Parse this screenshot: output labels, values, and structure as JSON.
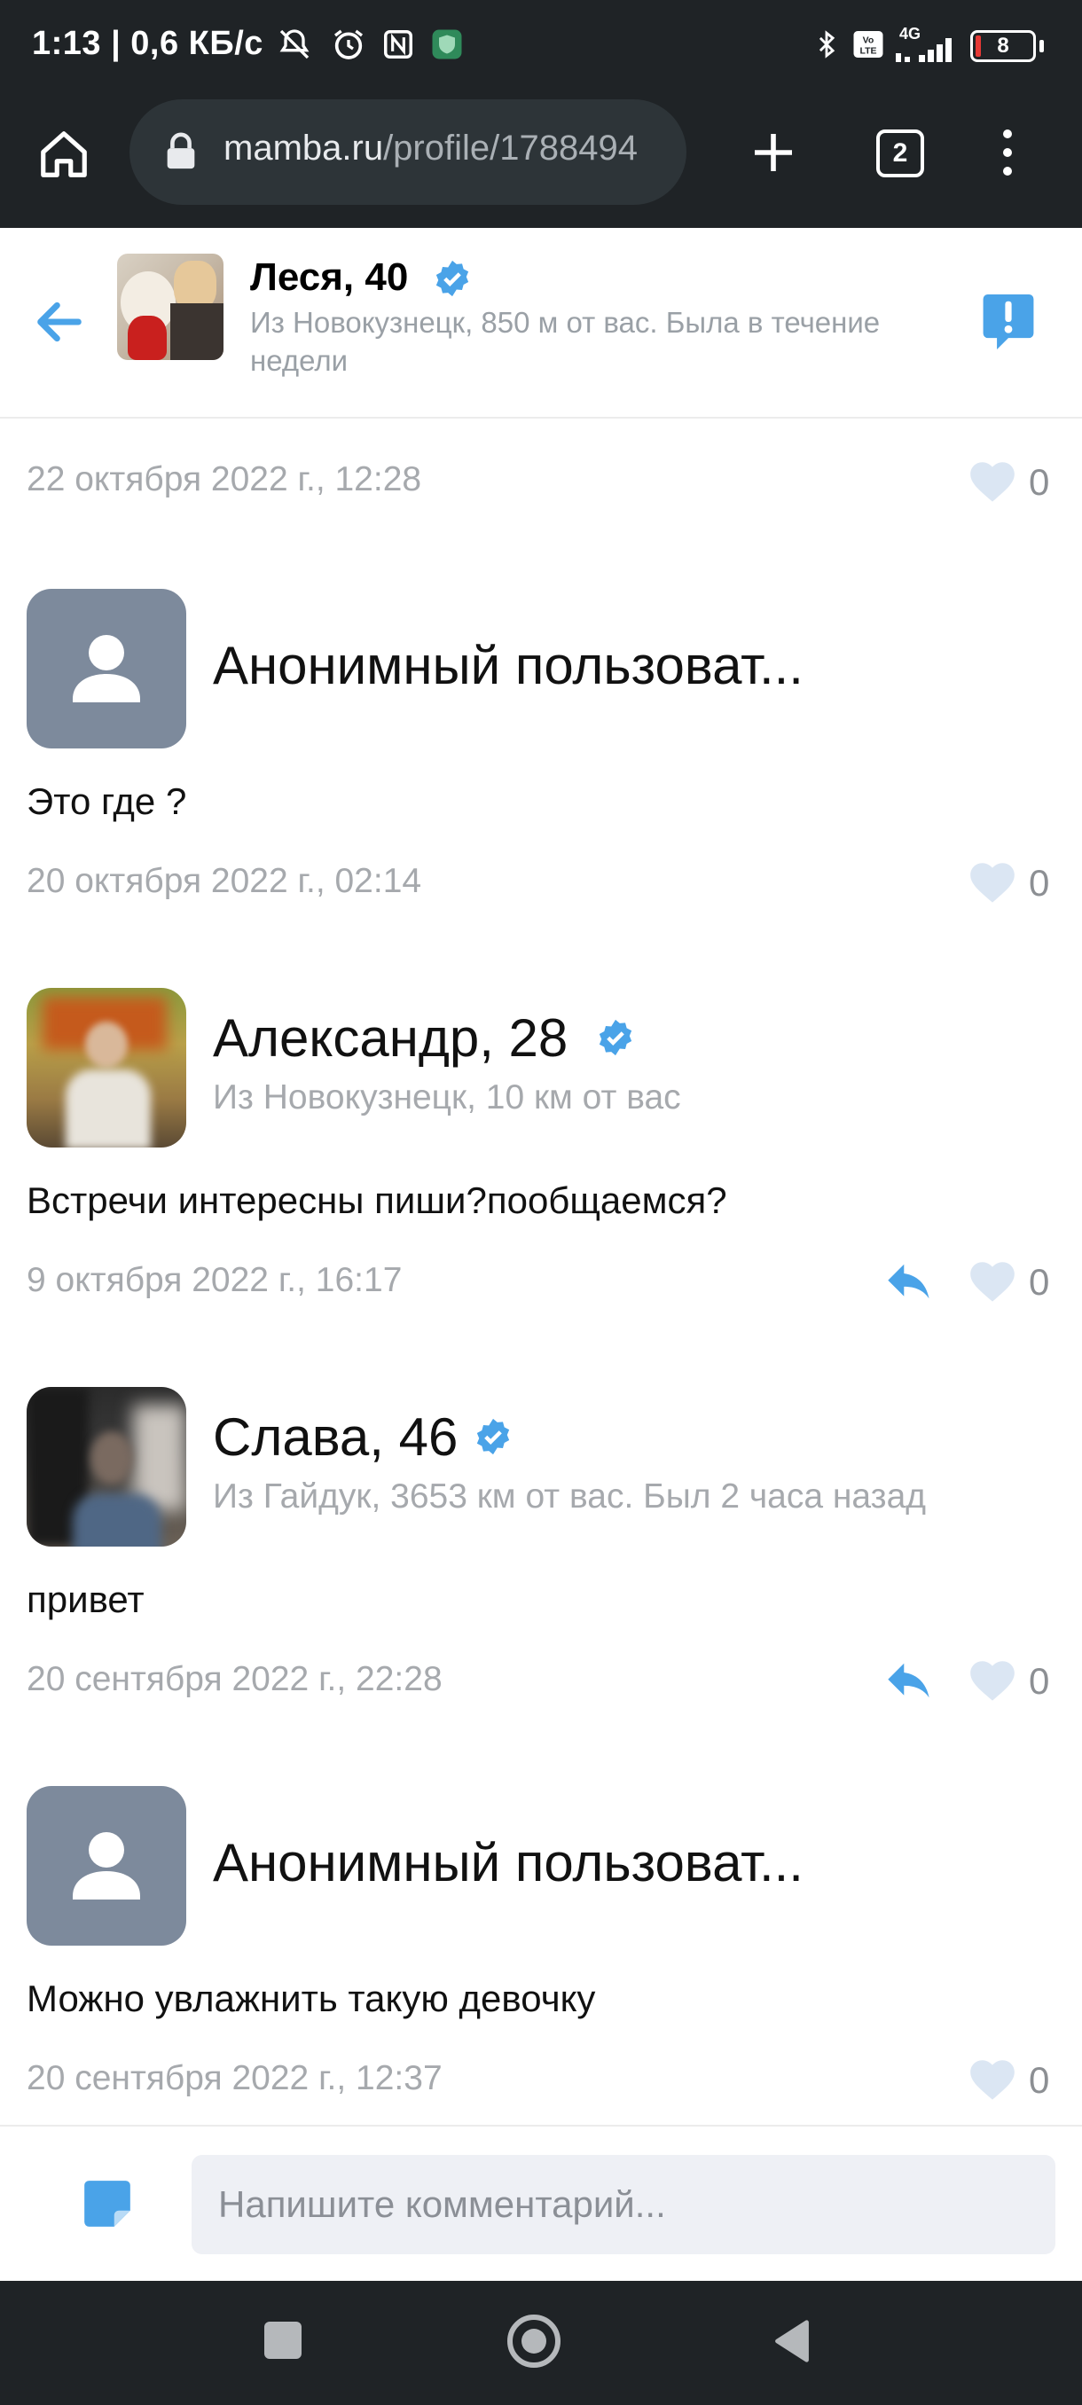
{
  "status_bar": {
    "time": "1:13 | 0,6 КБ/с",
    "network_label": "4G",
    "battery": "8"
  },
  "browser": {
    "url_host": "mamba.ru",
    "url_path": "/profile/1788494",
    "tab_count": "2"
  },
  "profile": {
    "name": "Леся, 40",
    "subtitle": "Из Новокузнецк, 850 м от вас. Была в течение недели"
  },
  "top_entry": {
    "date": "22 октября 2022 г., 12:28",
    "likes": "0"
  },
  "comments": [
    {
      "author": "Анонимный пользоват...",
      "text": "Это где ?",
      "date": "20 октября 2022 г., 02:14",
      "likes": "0"
    },
    {
      "author": "Александр, 28",
      "location": "Из Новокузнецк, 10 км от вас",
      "text": "Встречи интересны пиши?пообщаемся?",
      "date": "9 октября 2022 г., 16:17",
      "likes": "0"
    },
    {
      "author": "Слава, 46",
      "location": "Из Гайдук, 3653 км от вас. Был 2 часа назад",
      "text": "привет",
      "date": "20 сентября 2022 г., 22:28",
      "likes": "0"
    },
    {
      "author": "Анонимный пользоват...",
      "text": "Можно увлажнить такую девочку",
      "date": "20 сентября 2022 г., 12:37",
      "likes": "0"
    }
  ],
  "comment_input": {
    "placeholder": "Напишите комментарий..."
  },
  "colors": {
    "accent": "#4aa3e8",
    "dark_bar": "#1f2326",
    "anon_avatar": "#7d8a9c",
    "muted_text": "#a6a9ad",
    "heart": "#dbe6f3"
  },
  "icons": [
    "home-icon",
    "lock-icon",
    "plus-icon",
    "tabs-icon",
    "menu-dots-icon",
    "back-arrow-icon",
    "verified-icon",
    "report-icon",
    "heart-icon",
    "reply-icon",
    "sticker-icon",
    "nav-square-icon",
    "nav-circle-icon",
    "nav-back-icon"
  ]
}
